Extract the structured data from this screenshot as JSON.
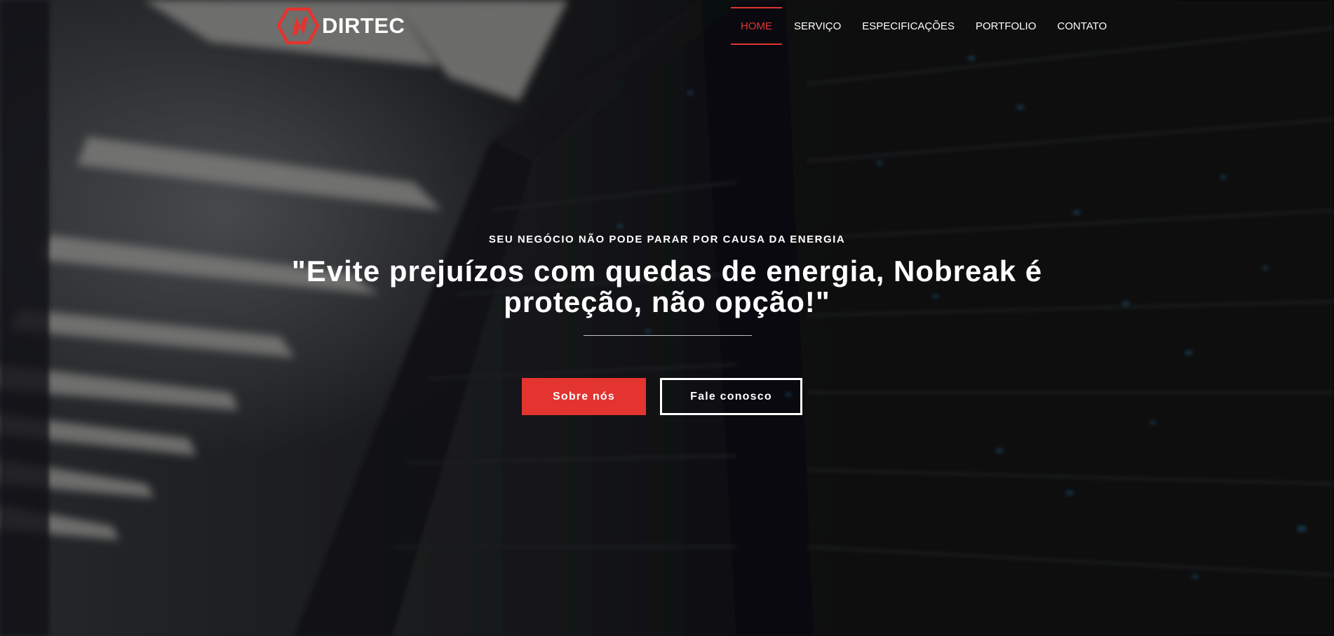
{
  "brand": {
    "name": "DIRTEC",
    "logo_icon": "lightning-hexagon-icon",
    "accent_color": "#e3342f"
  },
  "nav": {
    "items": [
      {
        "label": "HOME",
        "active": true
      },
      {
        "label": "SERVIÇO",
        "active": false
      },
      {
        "label": "ESPECIFICAÇÕES",
        "active": false
      },
      {
        "label": "PORTFOLIO",
        "active": false
      },
      {
        "label": "CONTATO",
        "active": false
      }
    ]
  },
  "hero": {
    "kicker": "SEU NEGÓCIO NÃO PODE PARAR POR CAUSA DA ENERGIA",
    "headline": "\"Evite prejuízos com quedas de energia, Nobreak é proteção, não opção!\"",
    "primary_button": "Sobre nós",
    "secondary_button": "Fale conosco"
  }
}
